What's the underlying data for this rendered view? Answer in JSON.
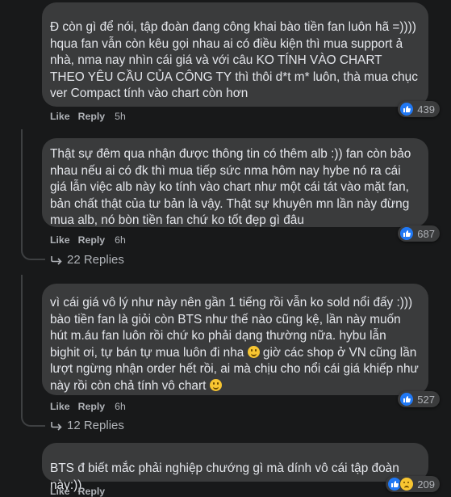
{
  "comments": [
    {
      "text": "Đ còn gì để nói, tập đoàn đang công khai bào tiền fan luôn hã =)))) hqua fan vẫn còn kêu gọi nhau ai có điều kiện thì mua support ả nhà, nma nay nhìn cái giá và với câu KO TÍNH VÀO CHART THEO YÊU CẦU CỦA CÔNG TY thì thôi d*t m* luôn, thà mua chục ver Compact tính vào chart còn hơn",
      "like": "Like",
      "reply": "Reply",
      "time": "5h",
      "reactions": "439"
    },
    {
      "text": "Thật sự đêm qua nhận được thông tin có thêm alb :)) fan còn bảo nhau nếu ai có đk thì mua tiếp sức nma hôm nay hybe nó ra cái giá lẫn việc alb này ko tính vào chart như một cái tát vào mặt fan, bản chất thật của tư bản là vậy. Thật sự khuyên mn lần này đừng mua alb, nó bòn tiền fan chứ ko tốt đẹp gì đâu",
      "like": "Like",
      "reply": "Reply",
      "time": "6h",
      "reactions": "687",
      "replies_label": "22 Replies"
    },
    {
      "text_a": "vì cái giá vô lý như này nên gần 1 tiếng rồi vẫn ko sold nổi đấy :))) bào tiền fan là giỏi còn BTS như thế nào cũng kệ, lần này muốn hút m.áu fan luôn rồi chứ ko phải dạng thường nữa. hybu lẫn bighit ơi, tự bán tự mua luôn đi nha",
      "text_b": "giờ các shop ở VN cũng lần lượt ngừng nhận order hết rồi, ai mà chịu cho nổi cái giá khiếp như này rồi còn chả tính vô chart",
      "like": "Like",
      "reply": "Reply",
      "time": "6h",
      "reactions": "527",
      "replies_label": "12 Replies"
    },
    {
      "text": "BTS đ biết mắc phải nghiệp chướng gì mà dính vô cái tập đoàn này:))",
      "like": "Like",
      "reply": "Reply",
      "reactions": "209"
    }
  ],
  "colors": {
    "background": "#18191a",
    "bubble": "#3a3b3c",
    "like_blue": "#2078f4",
    "muted": "#b0b3b8"
  }
}
